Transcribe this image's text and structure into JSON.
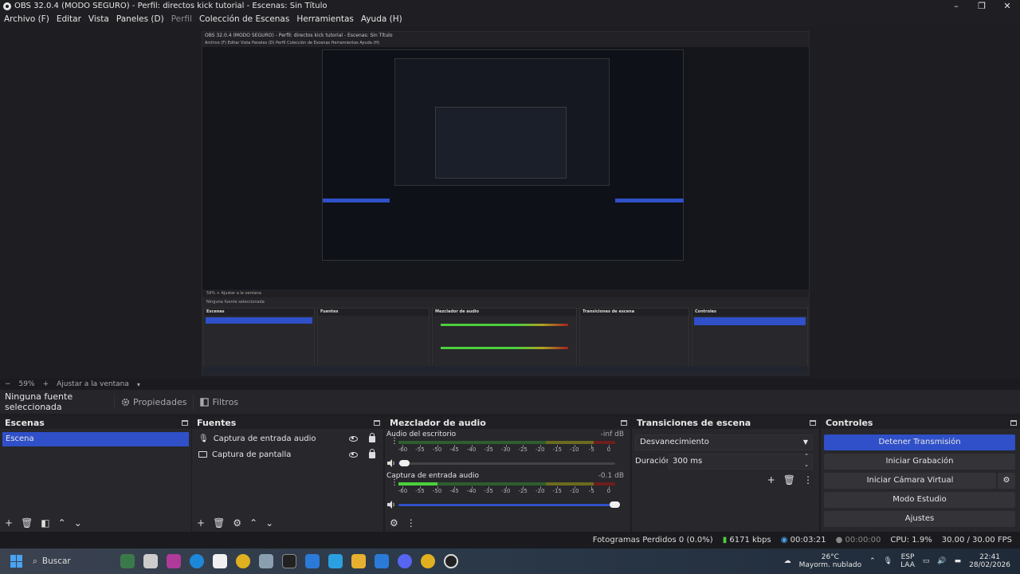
{
  "window": {
    "title": "OBS 32.0.4 (MODO SEGURO) - Perfil: directos kick tutorial - Escenas: Sin Título",
    "controls": [
      "–",
      "❐",
      "✕"
    ]
  },
  "menu": [
    {
      "label": "Archivo (F)",
      "enabled": true
    },
    {
      "label": "Editar",
      "enabled": true
    },
    {
      "label": "Vista",
      "enabled": true
    },
    {
      "label": "Paneles (D)",
      "enabled": true
    },
    {
      "label": "Perfil",
      "enabled": false
    },
    {
      "label": "Colección de Escenas",
      "enabled": true
    },
    {
      "label": "Herramientas",
      "enabled": true
    },
    {
      "label": "Ayuda (H)",
      "enabled": true
    }
  ],
  "zoom": {
    "minus": "−",
    "value": "59%",
    "plus": "+",
    "fit": "Ajustar a la ventana"
  },
  "sourcebar": {
    "no_source": "Ninguna fuente seleccionada",
    "properties": "Propiedades",
    "filters": "Filtros"
  },
  "scenes": {
    "title": "Escenas",
    "items": [
      "Escena"
    ]
  },
  "sources": {
    "title": "Fuentes",
    "items": [
      "Captura de entrada audio",
      "Captura de pantalla"
    ]
  },
  "mixer": {
    "title": "Mezclador de audio",
    "ticks": [
      "-60",
      "-55",
      "-50",
      "-45",
      "-40",
      "-35",
      "-30",
      "-25",
      "-20",
      "-15",
      "-10",
      "-5",
      "0"
    ],
    "channels": [
      {
        "name": "Audio del escritorio",
        "db": "-inf dB",
        "level": 0.0,
        "volume": 0.03
      },
      {
        "name": "Captura de entrada audio",
        "db": "-0.1 dB",
        "level": 0.18,
        "volume": 1.0
      }
    ]
  },
  "transitions": {
    "title": "Transiciones de escena",
    "selected": "Desvanecimiento",
    "duration_label": "Duración",
    "duration_value": "300 ms"
  },
  "controls": {
    "title": "Controles",
    "stop_stream": "Detener Transmisión",
    "start_rec": "Iniciar Grabación",
    "virtual_cam": "Iniciar Cámara Virtual",
    "studio": "Modo Estudio",
    "settings": "Ajustes"
  },
  "status": {
    "dropped": "Fotogramas Perdidos 0 (0.0%)",
    "bitrate": "6171 kbps",
    "stream_time": "00:03:21",
    "rec_time": "00:00:00",
    "cpu": "CPU: 1.9%",
    "fps": "30.00 / 30.00 FPS"
  },
  "taskbar": {
    "search": "Buscar",
    "weather_temp": "26°C",
    "weather_desc": "Mayorm. nublado",
    "lang1": "ESP",
    "lang2": "LAA",
    "time": "22:41",
    "date": "28/02/2026"
  },
  "preview_nested": {
    "title": "OBS 32.0.4 (MODO SEGURO) - Perfil: directos kick tutorial - Escenas: Sin Título",
    "menu": "Archivo (F)   Editar   Vista   Paneles (D)   Perfil   Colección de Escenas   Herramientas   Ayuda (H)",
    "zoom": "59%   +   Ajustar a la ventana",
    "no_source": "Ninguna fuente seleccionada",
    "panels": [
      "Escenas",
      "Fuentes",
      "Mezclador de audio",
      "Transiciones de escena",
      "Controles"
    ]
  },
  "colors": {
    "accent": "#2f50c8",
    "meter_green": "#4ccf3c",
    "bg": "#1e1e22",
    "panel": "#27272c"
  }
}
